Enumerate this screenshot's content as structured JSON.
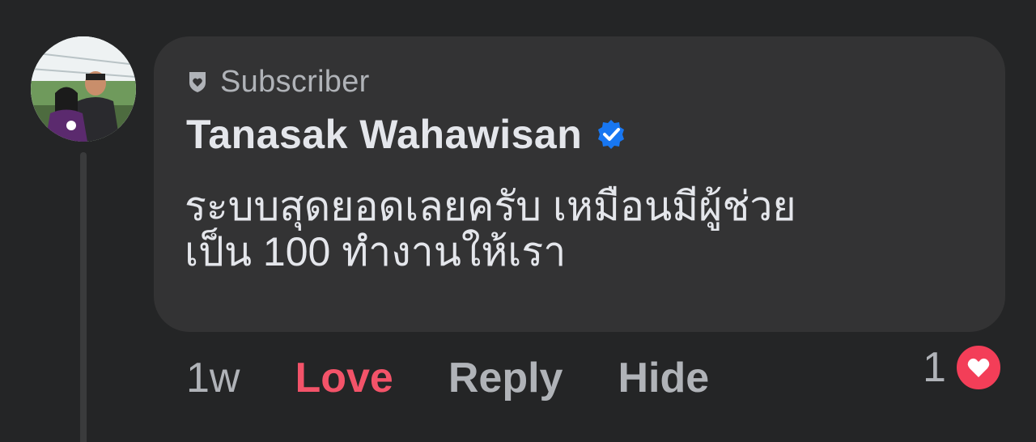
{
  "comment": {
    "badge": {
      "label": "Subscriber",
      "icon": "subscriber-shield-icon"
    },
    "author": {
      "name": "Tanasak Wahawisan",
      "verified_icon": "verified-badge-icon",
      "verified_color": "#1877f2"
    },
    "text": "ระบบสุดยอดเลยครับ เหมือนมีผู้ช่วย\nเป็น 100 ทำงานให้เรา",
    "actions": {
      "time": "1w",
      "love_label": "Love",
      "reply_label": "Reply",
      "hide_label": "Hide"
    },
    "reactions": {
      "count": "1",
      "icon": "heart-reaction-icon",
      "color": "#f33e58"
    }
  },
  "colors": {
    "background": "#242526",
    "bubble": "#333334",
    "love_active": "#f35369",
    "secondary_text": "#b0b3b8",
    "primary_text": "#e4e6eb"
  }
}
